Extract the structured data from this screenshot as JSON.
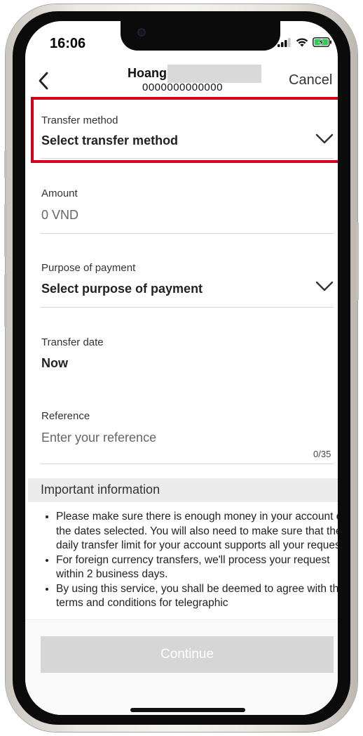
{
  "status_bar": {
    "time": "16:06"
  },
  "header": {
    "recipient_name": "Hoang",
    "account_number": "0000000000000",
    "cancel_label": "Cancel"
  },
  "form": {
    "transfer_method": {
      "label": "Transfer method",
      "value": "Select transfer method"
    },
    "amount": {
      "label": "Amount",
      "value": "0 VND"
    },
    "purpose": {
      "label": "Purpose of payment",
      "value": "Select purpose of payment"
    },
    "transfer_date": {
      "label": "Transfer date",
      "value": "Now"
    },
    "reference": {
      "label": "Reference",
      "placeholder": "Enter your reference",
      "counter": "0/35"
    }
  },
  "important_info": {
    "title": "Important information",
    "items": [
      "Please make sure there is enough money in your account on the dates selected. You will also need to make sure that the daily transfer limit for your account supports all your requests.",
      "For foreign currency transfers, we'll process your request within 2 business days.",
      "By using this service, you shall be deemed to agree with the terms and conditions for telegraphic"
    ]
  },
  "footer": {
    "continue_label": "Continue"
  },
  "colors": {
    "highlight": "#d0021b",
    "button_disabled": "#d6d6d6",
    "info_bar": "#ececec"
  },
  "icons": [
    "back-arrow-icon",
    "chevron-down-icon",
    "signal-icon",
    "wifi-icon",
    "battery-charging-icon"
  ]
}
